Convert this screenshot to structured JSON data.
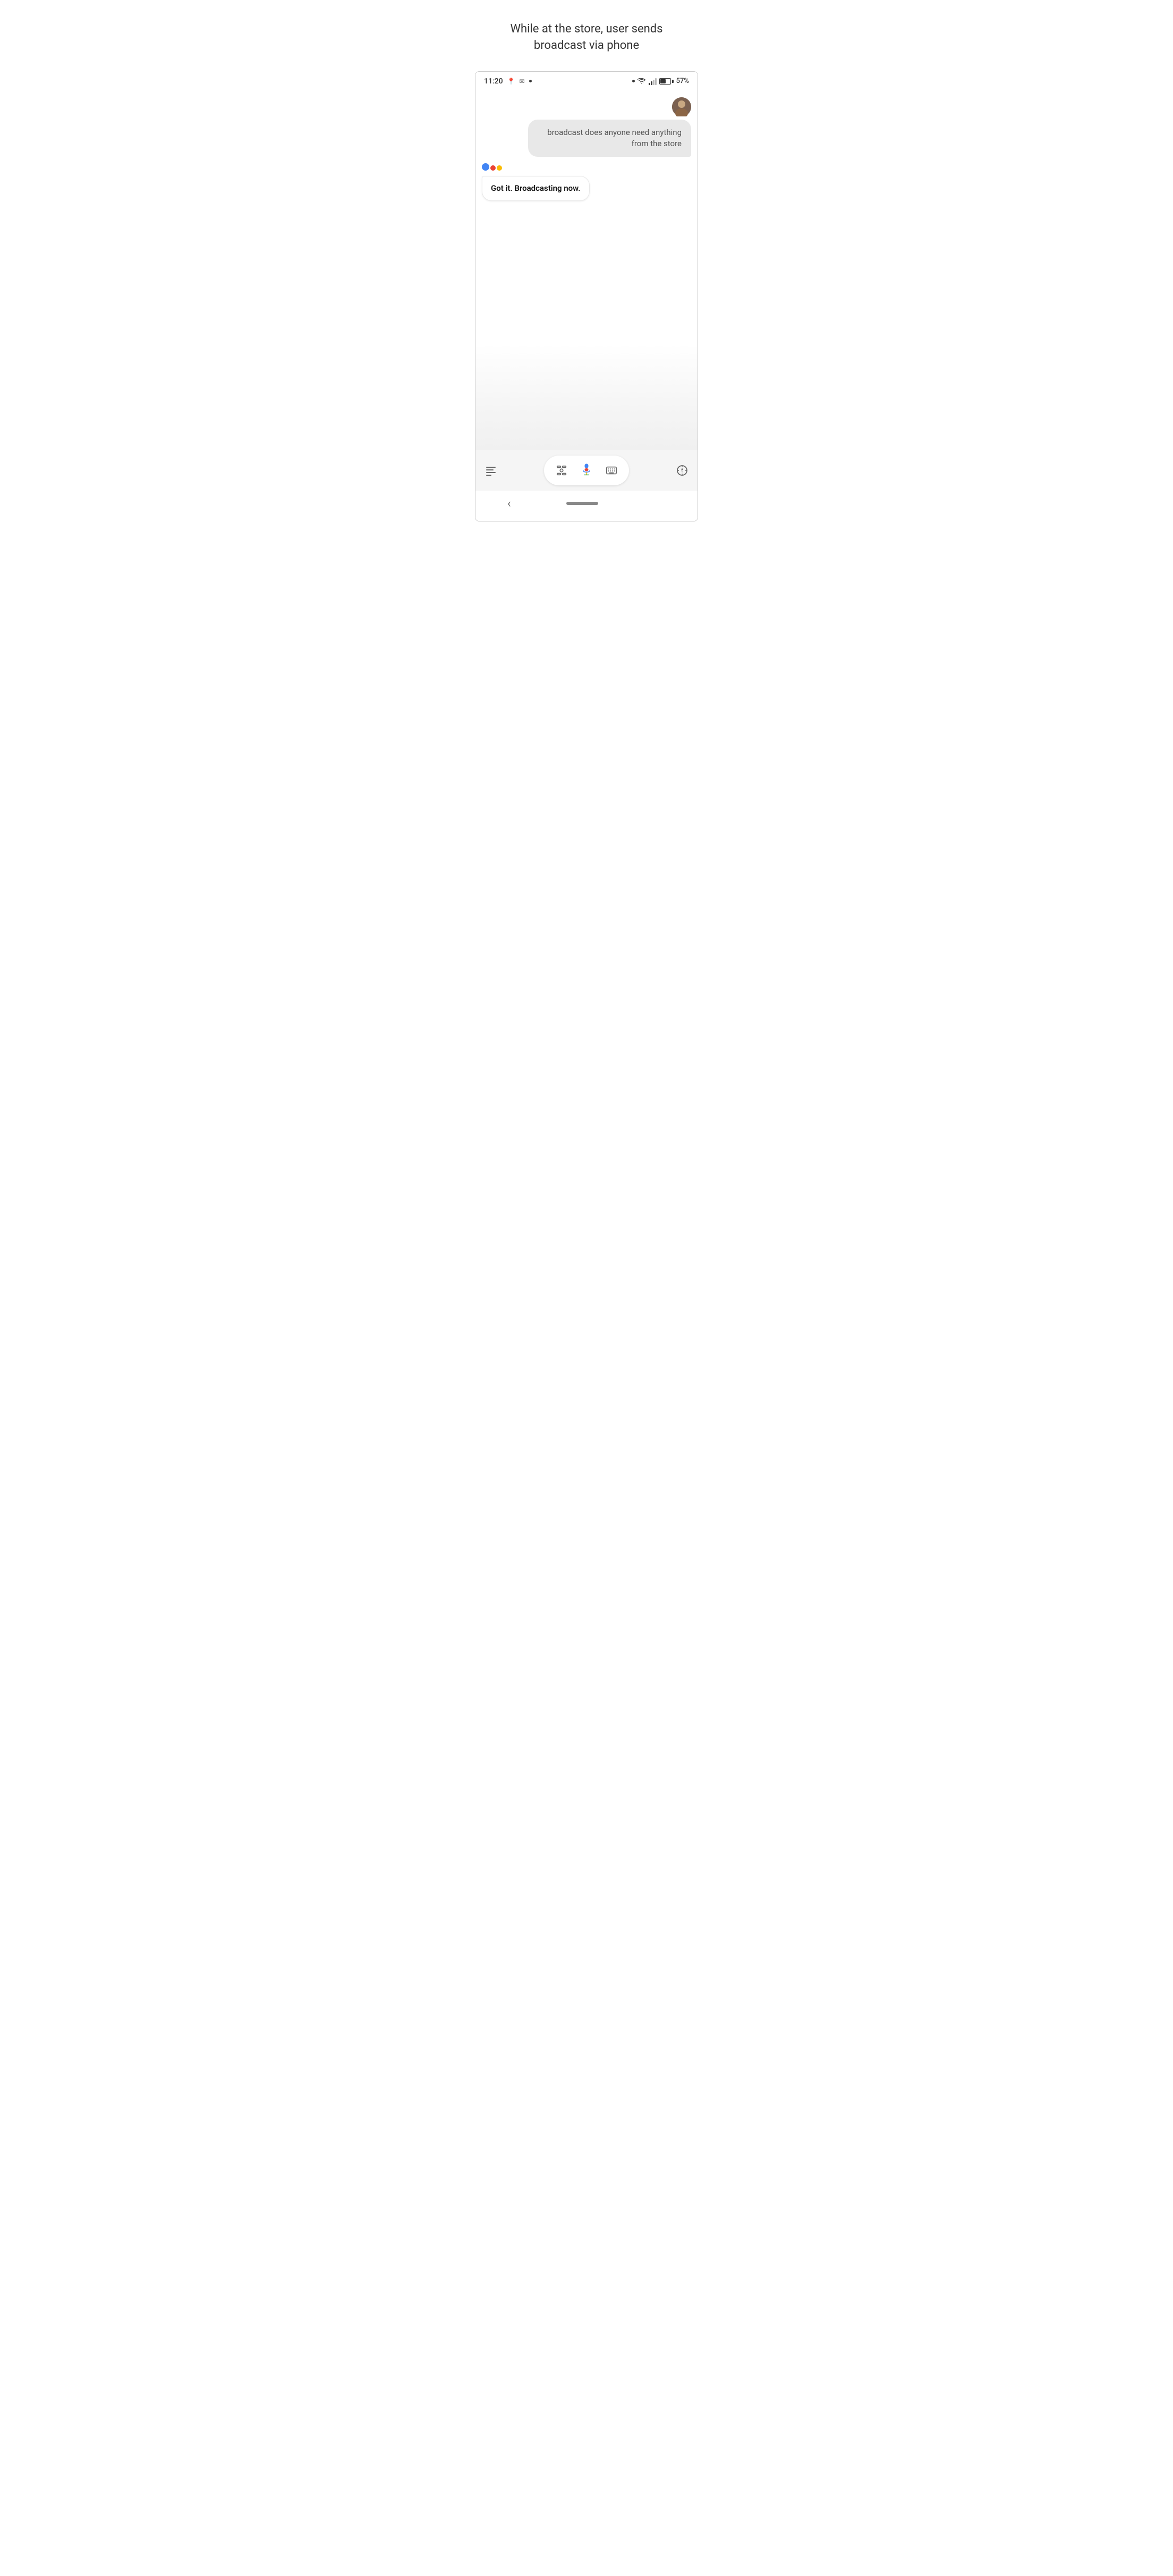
{
  "page": {
    "title_line1": "While at the store, user sends",
    "title_line2": "broadcast via phone"
  },
  "status_bar": {
    "time": "11:20",
    "battery_percent": "57%"
  },
  "chat": {
    "user_message": "broadcast does anyone need anything from the store",
    "assistant_message": "Got it. Broadcasting now."
  },
  "toolbar": {
    "icons": {
      "text_icon": "☰",
      "screenshot_icon": "⊡",
      "keyboard_icon": "⌨",
      "compass_icon": "◎"
    }
  },
  "nav": {
    "back_label": "‹"
  }
}
